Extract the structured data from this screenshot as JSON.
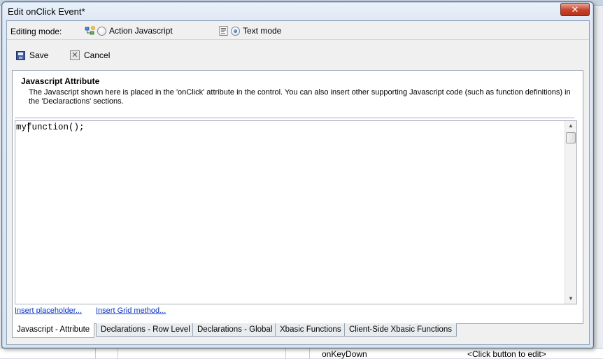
{
  "window": {
    "title": "Edit onClick Event*",
    "close_label": "✕"
  },
  "background_app": {
    "grid_row": {
      "event_name": "onKeyDown",
      "event_value": "<Click button to edit>"
    }
  },
  "editing_mode": {
    "label": "Editing mode:",
    "options": [
      {
        "label": "Action Javascript",
        "selected": false,
        "icon": "action-javascript-icon"
      },
      {
        "label": "Text mode",
        "selected": true,
        "icon": "text-mode-icon"
      }
    ]
  },
  "toolbar": {
    "save_label": "Save",
    "cancel_label": "Cancel"
  },
  "panel": {
    "heading": "Javascript Attribute",
    "description": "The Javascript shown here is placed in the 'onClick' attribute in the control. You can also insert other supporting Javascript code (such as function definitions) in the 'Declaractions' sections."
  },
  "editor": {
    "code": "myfunction();"
  },
  "links": {
    "insert_placeholder": "Insert placeholder...",
    "insert_grid_method": "Insert Grid method..."
  },
  "tabs": [
    {
      "label": "Javascript - Attribute",
      "active": true
    },
    {
      "label": "Declarations - Row Level",
      "active": false
    },
    {
      "label": "Declarations - Global",
      "active": false
    },
    {
      "label": "Xbasic Functions",
      "active": false
    },
    {
      "label": "Client-Side Xbasic Functions",
      "active": false
    }
  ],
  "colors": {
    "link": "#0a36c2",
    "close_button": "#c6432d",
    "selected_radio": "#1d4f91"
  }
}
